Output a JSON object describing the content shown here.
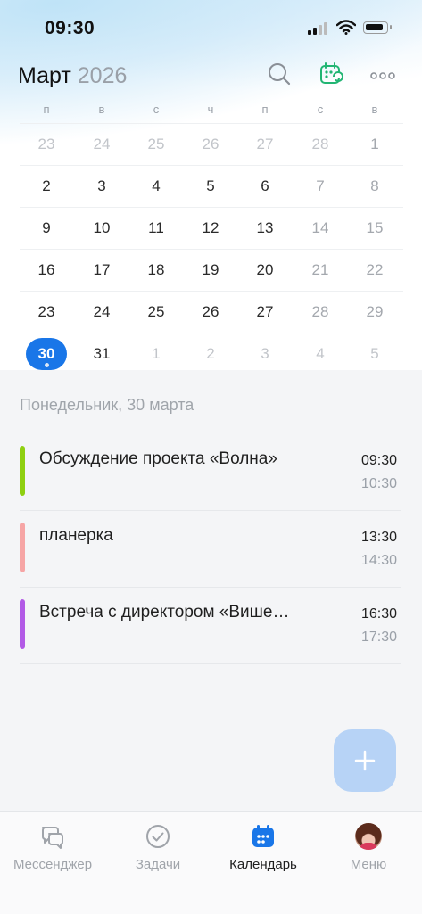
{
  "status_bar": {
    "time": "09:30"
  },
  "header": {
    "month": "Март",
    "year": "2026"
  },
  "weekdays": [
    "п",
    "в",
    "с",
    "ч",
    "п",
    "с",
    "в"
  ],
  "calendar_rows": [
    [
      "23",
      "24",
      "25",
      "26",
      "27",
      "28",
      "1"
    ],
    [
      "2",
      "3",
      "4",
      "5",
      "6",
      "7",
      "8"
    ],
    [
      "9",
      "10",
      "11",
      "12",
      "13",
      "14",
      "15"
    ],
    [
      "16",
      "17",
      "18",
      "19",
      "20",
      "21",
      "22"
    ],
    [
      "23",
      "24",
      "25",
      "26",
      "27",
      "28",
      "29"
    ],
    [
      "30",
      "31",
      "1",
      "2",
      "3",
      "4",
      "5"
    ]
  ],
  "selected_date_label": "Понедельник, 30 марта",
  "events": [
    {
      "title": "Обсуждение проекта «Волна»",
      "start": "09:30",
      "end": "10:30",
      "color": "#8fd011"
    },
    {
      "title": "планерка",
      "start": "13:30",
      "end": "14:30",
      "color": "#f6a5a5"
    },
    {
      "title": "Встреча с директором «Више…",
      "start": "16:30",
      "end": "17:30",
      "color": "#b25ae6"
    }
  ],
  "tabs": [
    {
      "label": "Мессенджер",
      "icon": "messenger-icon"
    },
    {
      "label": "Задачи",
      "icon": "tasks-check-icon"
    },
    {
      "label": "Календарь",
      "icon": "calendar-icon"
    },
    {
      "label": "Меню",
      "icon": "avatar"
    }
  ],
  "colors": {
    "accent": "#1976e8",
    "fab": "#b7d3f6",
    "calendar_icon": "#22b573"
  }
}
